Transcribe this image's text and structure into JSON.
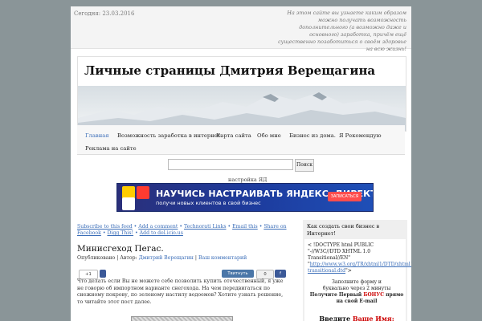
{
  "topbar": {
    "date": "Сегодня: 23.03.2016",
    "tagline": "На этом сайте вы узнаете каким образом можно получать возможность дополнительного (а возможно даже и основного) заработка, причём ещё существенно позаботиться о своём здоровье на всю жизнь!"
  },
  "header": {
    "title": "Личные страницы Дмитрия Верещагина"
  },
  "nav": {
    "items": [
      {
        "label": "Главная"
      },
      {
        "label": "Возможность заработка в интернет."
      },
      {
        "label": "Карта сайта"
      },
      {
        "label": "Обо мне"
      },
      {
        "label": "Бизнес из дома."
      },
      {
        "label": "Я Рекомендую"
      },
      {
        "label": "Реклама на сайте"
      }
    ]
  },
  "search": {
    "button_label": "Поиск",
    "settings_label": "настройка ЯД"
  },
  "ad": {
    "title": "НАУЧИСЬ НАСТРАИВАТЬ ЯНДЕКС. ДИРЕКТ",
    "subtitle": "получи новых клиентов в свой бизнес",
    "button": "ЗАПИСАТЬСЯ"
  },
  "share_links": [
    "Subscribe to this feed",
    "Add a comment",
    "Technorati Links",
    "Email this",
    "Share on Facebook",
    "Digg This!",
    "Add to del.icio.us"
  ],
  "post": {
    "title": "Минисгеход Пегас.",
    "published_label": "Опубликовано | Автор:",
    "author": "Дмитрий Верещагин",
    "comment_link": "Ваш комментарий",
    "social": {
      "g_plus": "+1",
      "vk": "Твитнуть",
      "gray": "0",
      "fb": "f"
    },
    "text": "Что делать если Вы не можете себе позволить купить отечественный, я уже не говорю об импортном варианте снегохода. На чем передвигаться по снежному покрову, по зеленому настилу водоемов? Хотите узнать решение, то читайте этот пост далее."
  },
  "sidebar": {
    "title": "Как создать свои бизнес в Интернет!",
    "doctype_text": "< !DOCTYPE html PUBLIC \"-//W3C//DTD XHTML 1.0 Transitional//EN\"",
    "doctype_link": "http://www.w3.org/TR/xhtml1/DTD/xhtml1-transitional.dtd",
    "promo_line1": "Заполните форму и",
    "promo_line2": "буквально через 2 минуты",
    "promo_line3_a": "Получите Первый",
    "promo_bonus": "БОНУС",
    "promo_line3_b": "прямо на свой E-mail",
    "enter_a": "Введите",
    "enter_b": "Ваше Имя:"
  },
  "colors": {
    "background": "#8a9598",
    "link": "#3a6db8",
    "ad_blue": "#1d3c9e",
    "accent_red": "#c00000"
  }
}
